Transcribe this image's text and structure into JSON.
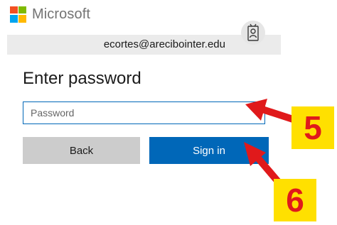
{
  "brand": {
    "name": "Microsoft",
    "colors": [
      "#f25022",
      "#7fba00",
      "#00a4ef",
      "#ffb900"
    ]
  },
  "identity": {
    "email": "ecortes@arecibointer.edu",
    "icon": "badge-icon"
  },
  "page": {
    "title": "Enter password"
  },
  "form": {
    "password_placeholder": "Password",
    "password_value": ""
  },
  "buttons": {
    "back_label": "Back",
    "signin_label": "Sign in"
  },
  "annotations": {
    "step_5": "5",
    "step_6": "6",
    "arrow_color": "#e0191b",
    "callout_bg": "#ffe000"
  }
}
